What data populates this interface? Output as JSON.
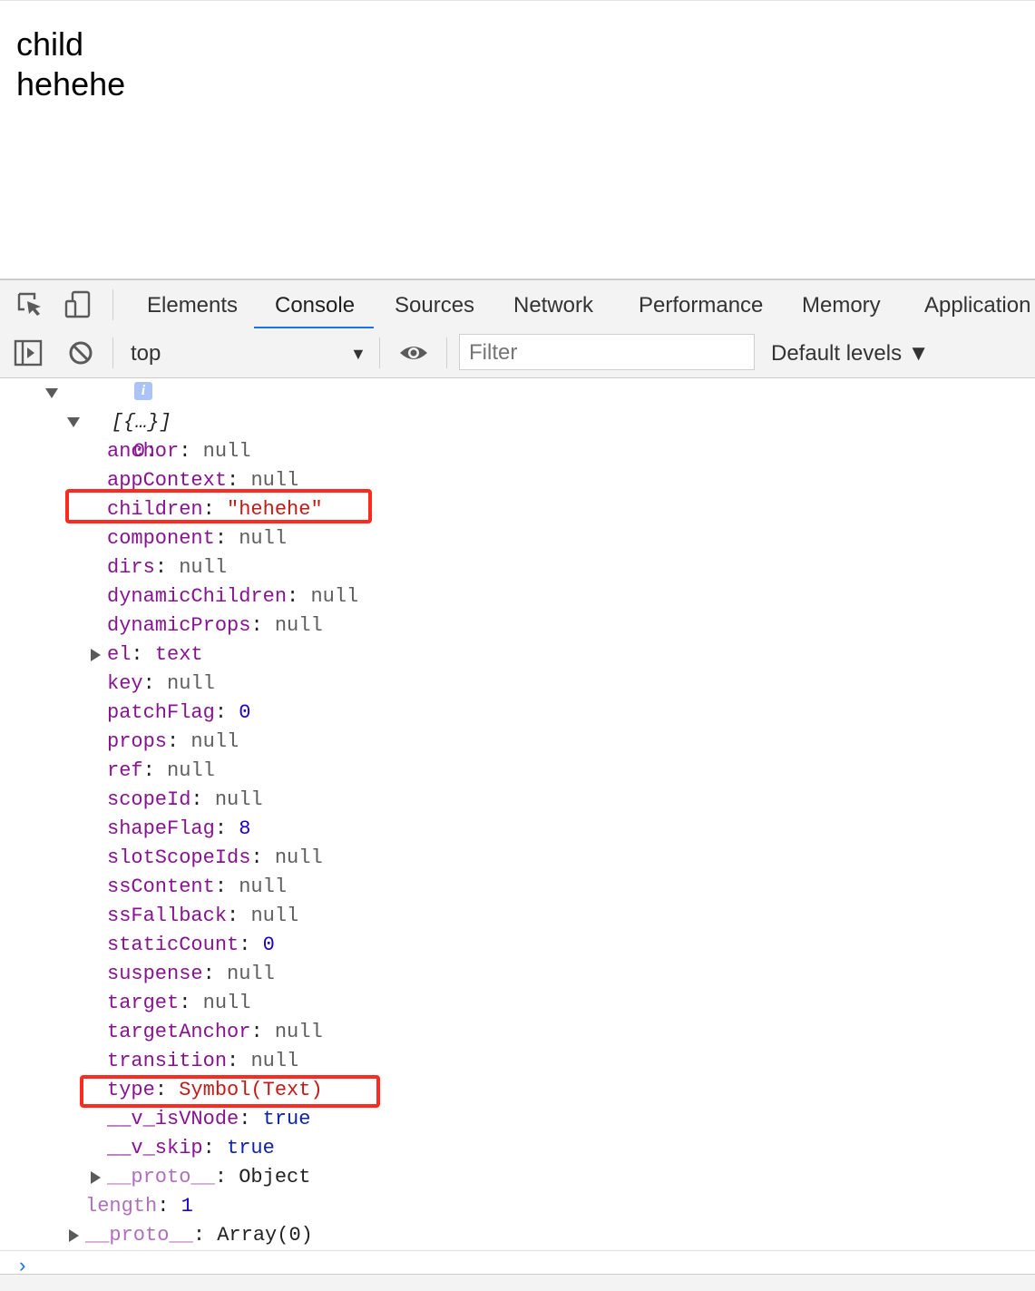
{
  "page": {
    "lines": [
      "child",
      "hehehe"
    ]
  },
  "devtools": {
    "tabs": [
      "Elements",
      "Console",
      "Sources",
      "Network",
      "Performance",
      "Memory",
      "Application"
    ],
    "active_tab": "Console",
    "toolbar": {
      "context": "top",
      "filter_placeholder": "Filter",
      "levels": "Default levels ▼"
    }
  },
  "console": {
    "array_preview": "[{…}]",
    "index_label": "0:",
    "props": [
      {
        "key": "anchor",
        "value": "null",
        "type": "null"
      },
      {
        "key": "appContext",
        "value": "null",
        "type": "null"
      },
      {
        "key": "children",
        "value": "\"hehehe\"",
        "type": "string"
      },
      {
        "key": "component",
        "value": "null",
        "type": "null"
      },
      {
        "key": "dirs",
        "value": "null",
        "type": "null"
      },
      {
        "key": "dynamicChildren",
        "value": "null",
        "type": "null"
      },
      {
        "key": "dynamicProps",
        "value": "null",
        "type": "null"
      },
      {
        "key": "el",
        "value": "text",
        "type": "object-link"
      },
      {
        "key": "key",
        "value": "null",
        "type": "null"
      },
      {
        "key": "patchFlag",
        "value": "0",
        "type": "number"
      },
      {
        "key": "props",
        "value": "null",
        "type": "null"
      },
      {
        "key": "ref",
        "value": "null",
        "type": "null"
      },
      {
        "key": "scopeId",
        "value": "null",
        "type": "null"
      },
      {
        "key": "shapeFlag",
        "value": "8",
        "type": "number"
      },
      {
        "key": "slotScopeIds",
        "value": "null",
        "type": "null"
      },
      {
        "key": "ssContent",
        "value": "null",
        "type": "null"
      },
      {
        "key": "ssFallback",
        "value": "null",
        "type": "null"
      },
      {
        "key": "staticCount",
        "value": "0",
        "type": "number"
      },
      {
        "key": "suspense",
        "value": "null",
        "type": "null"
      },
      {
        "key": "target",
        "value": "null",
        "type": "null"
      },
      {
        "key": "targetAnchor",
        "value": "null",
        "type": "null"
      },
      {
        "key": "transition",
        "value": "null",
        "type": "null"
      },
      {
        "key": "type",
        "value": "Symbol(Text)",
        "type": "symbol"
      },
      {
        "key": "__v_isVNode",
        "value": "true",
        "type": "boolean"
      },
      {
        "key": "__v_skip",
        "value": "true",
        "type": "boolean"
      },
      {
        "key": "__proto__",
        "value": "Object",
        "type": "object"
      }
    ],
    "length_key": "length",
    "length_value": "1",
    "array_proto_key": "__proto__",
    "array_proto_value": "Array(0)",
    "prompt": "›"
  },
  "colors": {
    "highlight": "#ff2a1f",
    "accent": "#1a73e8"
  }
}
